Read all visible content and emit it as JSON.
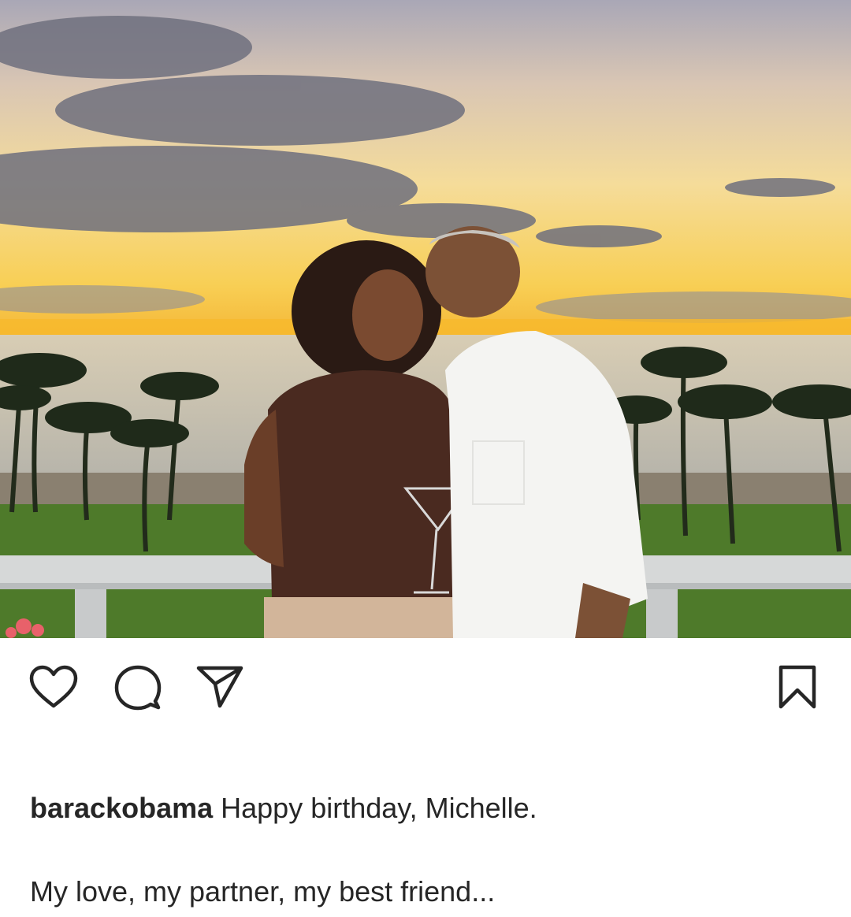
{
  "post": {
    "image": {
      "alt_icon": "photo-couple-sunset",
      "colors": {
        "sky_top": "#a8a6b4",
        "sky_mid": "#f2d79a",
        "horizon": "#f7c63a",
        "sea": "#c9c1b0",
        "clouds": "#6f707e",
        "palm": "#1f2a1a",
        "grass": "#4e7a2a",
        "dress": "#4a2a20",
        "shirt": "#f4f4f2",
        "railing": "#d6d8d8"
      }
    },
    "actions": {
      "like_icon": "heart-icon",
      "comment_icon": "comment-icon",
      "share_icon": "send-icon",
      "save_icon": "bookmark-icon"
    },
    "caption": {
      "username": "barackobama",
      "text": "Happy birthday, Michelle.",
      "line2": "My love, my partner, my best friend..."
    }
  }
}
